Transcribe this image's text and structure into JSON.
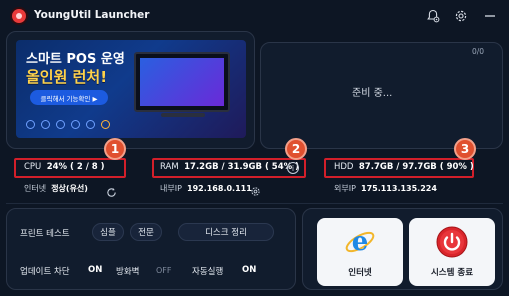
{
  "app": {
    "title": "YoungUtil Launcher"
  },
  "banner": {
    "headline": "스마트 POS 운영",
    "highlight": "올인원 런처!",
    "button_label": "클릭해서 기능확인 ▶"
  },
  "status_panel": {
    "counter": "0/0",
    "message": "준비 중..."
  },
  "stats": {
    "cpu": {
      "label": "CPU",
      "value": "24% ( 2 / 8 )",
      "badge": "1"
    },
    "ram": {
      "label": "RAM",
      "value": "17.2GB / 31.9GB ( 54% )",
      "badge": "2"
    },
    "hdd": {
      "label": "HDD",
      "value": "87.7GB / 97.7GB ( 90% )",
      "badge": "3"
    }
  },
  "network": {
    "internet_label": "인터넷",
    "internet_value": "정상(유선)",
    "internal_ip_label": "내부IP",
    "internal_ip": "192.168.0.111",
    "external_ip_label": "외부IP",
    "external_ip": "175.113.135.224"
  },
  "print_test": {
    "label": "프린트 테스트",
    "simple": "심플",
    "full": "전문",
    "disk_cleanup": "디스크 정리"
  },
  "settings": {
    "update_block_label": "업데이트 차단",
    "update_block_value": "ON",
    "firewall_label": "방화벽",
    "firewall_value": "OFF",
    "autorun_label": "자동실행",
    "autorun_value": "ON"
  },
  "tiles": {
    "internet": "인터넷",
    "shutdown": "시스템 종료"
  },
  "colors": {
    "highlight_border": "#d21f2a",
    "badge": "#e0502f",
    "background": "#0d1624",
    "shutdown_red": "#d9252b",
    "ie_blue": "#1e88e5"
  },
  "icons": [
    "app-logo-icon",
    "notification-settings-icon",
    "gear-icon",
    "minimize-icon",
    "info-icon",
    "refresh-icon",
    "internet-explorer-icon",
    "power-icon"
  ]
}
